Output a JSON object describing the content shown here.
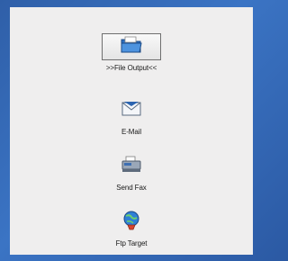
{
  "options": [
    {
      "label": "File Output",
      "prefix": ">>",
      "suffix": "<<",
      "icon": "folder-icon",
      "selected": true
    },
    {
      "label": "E-Mail",
      "icon": "envelope-icon",
      "selected": false
    },
    {
      "label": "Send Fax",
      "icon": "fax-icon",
      "selected": false
    },
    {
      "label": "Ftp Target",
      "icon": "globe-icon",
      "selected": false
    }
  ]
}
